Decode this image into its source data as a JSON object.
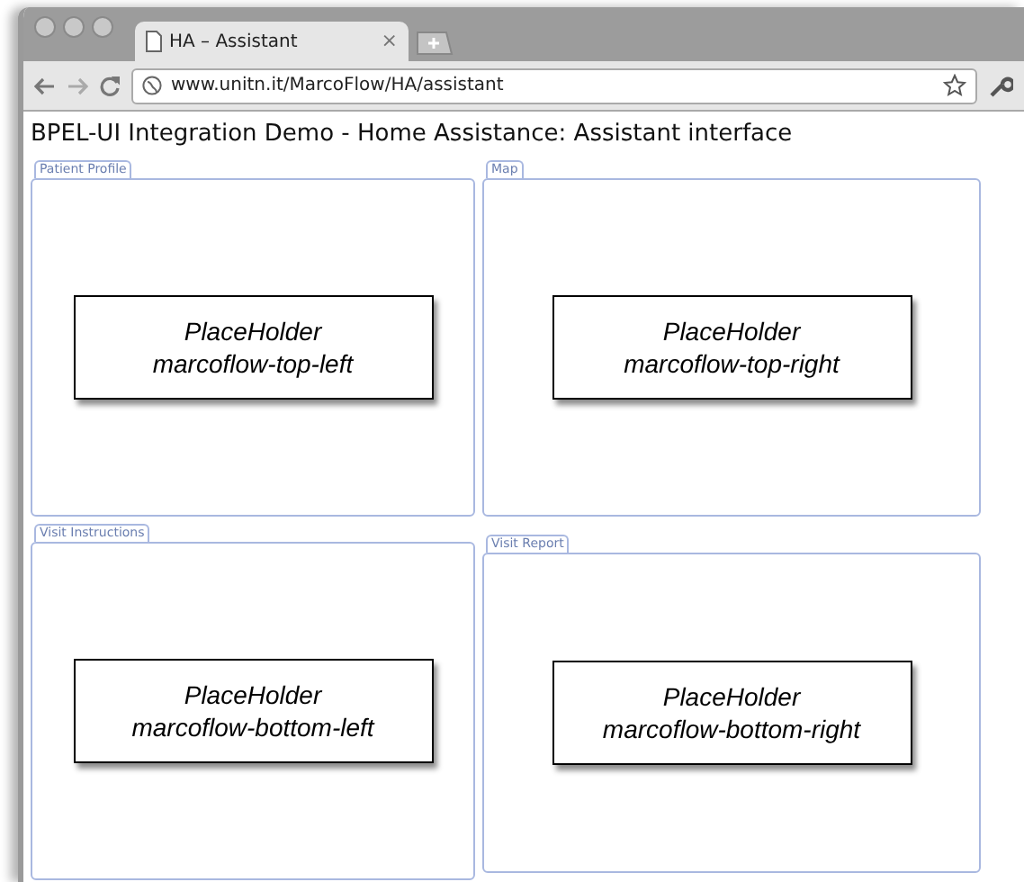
{
  "tab": {
    "title": "HA – Assistant",
    "close": "×",
    "selected": true
  },
  "address_bar": {
    "url": "www.unitn.it/MarcoFlow/HA/assistant"
  },
  "page_title": "BPEL-UI Integration Demo - Home Assistance: Assistant interface",
  "panels": [
    {
      "label": "Patient Profile",
      "placeholder": [
        "PlaceHolder",
        "marcoflow-top-left"
      ]
    },
    {
      "label": "Map",
      "placeholder": [
        "PlaceHolder",
        "marcoflow-top-right"
      ]
    },
    {
      "label": "Visit Instructions",
      "placeholder": [
        "PlaceHolder",
        "marcoflow-bottom-left"
      ]
    },
    {
      "label": "Visit Report",
      "placeholder": [
        "PlaceHolder",
        "marcoflow-bottom-right"
      ]
    }
  ]
}
